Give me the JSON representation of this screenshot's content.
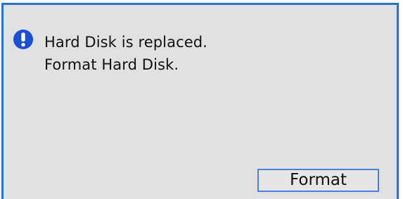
{
  "dialog": {
    "icon": "exclamation-circle-icon",
    "accent_color": "#2f6fd0",
    "icon_color": "#1a4fd6",
    "message_lines": [
      "Hard Disk is replaced.",
      "Format Hard Disk."
    ],
    "button_label": "Format"
  }
}
